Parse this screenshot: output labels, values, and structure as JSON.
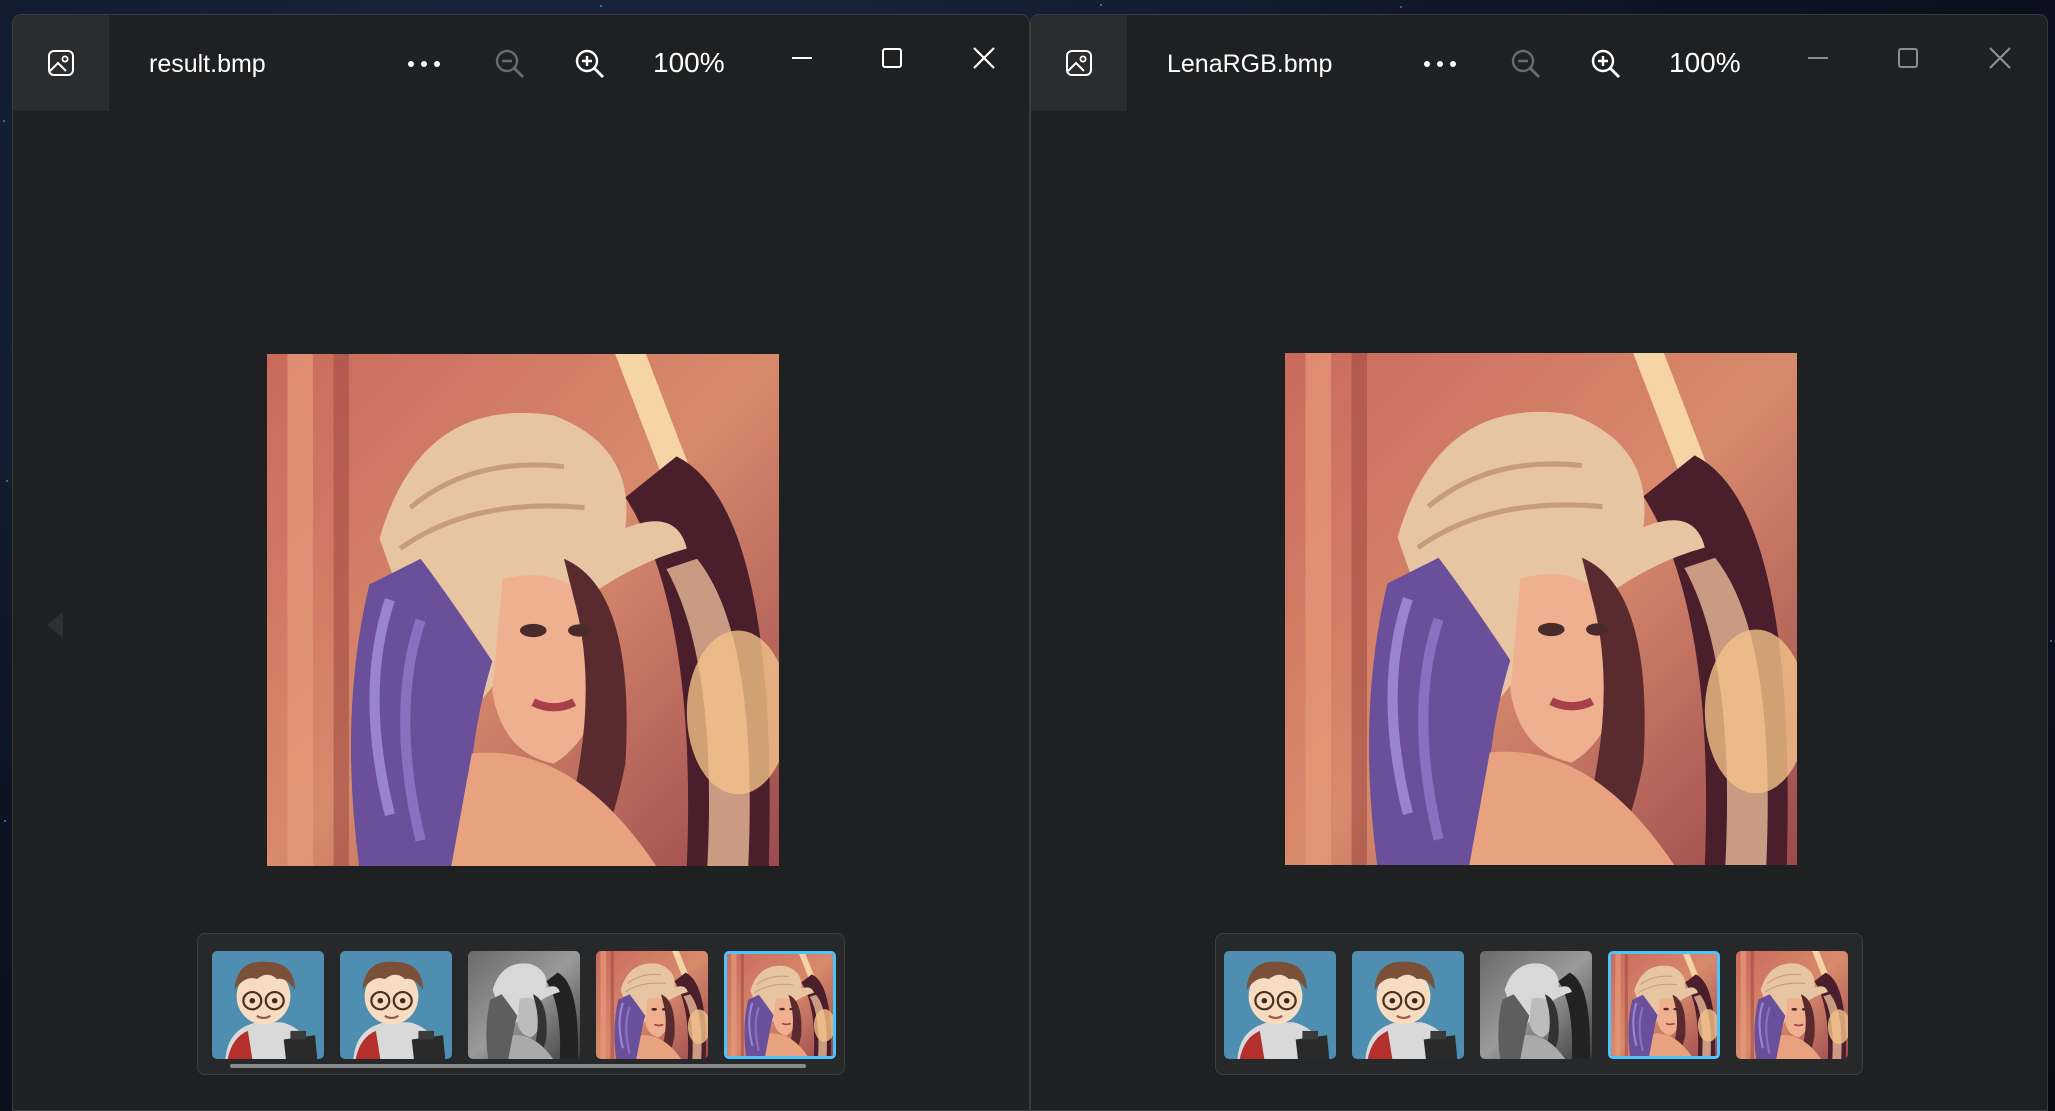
{
  "left_window": {
    "title": "result.bmp",
    "zoom": "100%",
    "selected_thumbnail_index": 4
  },
  "right_window": {
    "title": "LenaRGB.bmp",
    "zoom": "100%",
    "selected_thumbnail_index": 3
  },
  "thumbnails": [
    {
      "kind": "cartoon-avatar"
    },
    {
      "kind": "cartoon-avatar"
    },
    {
      "kind": "grayscale-portrait"
    },
    {
      "kind": "color-portrait"
    },
    {
      "kind": "color-portrait"
    }
  ],
  "icons": {
    "app": "photos-app-icon",
    "more": "more-options-icon",
    "zoom_out": "zoom-out-icon",
    "zoom_in": "zoom-in-icon",
    "minimize": "minimize-icon",
    "maximize": "maximize-icon",
    "close": "close-icon",
    "prev": "previous-image-arrow-icon"
  },
  "colors": {
    "window_bg": "#1f2022",
    "selection_border": "#4cc2ff",
    "text": "#ffffff"
  }
}
